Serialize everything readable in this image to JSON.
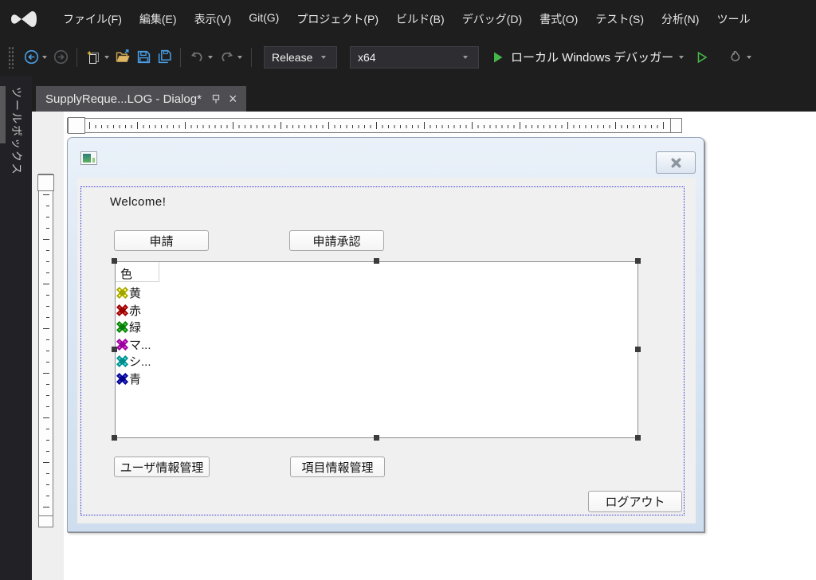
{
  "menu_bar": {
    "items": [
      "ファイル(F)",
      "編集(E)",
      "表示(V)",
      "Git(G)",
      "プロジェクト(P)",
      "ビルド(B)",
      "デバッグ(D)",
      "書式(O)",
      "テスト(S)",
      "分析(N)",
      "ツール"
    ]
  },
  "toolbar": {
    "configuration": "Release",
    "platform": "x64",
    "run_label": "ローカル Windows デバッガー",
    "icons": [
      "navigate-back",
      "navigate-forward",
      "new-item",
      "open-file",
      "save",
      "save-all",
      "undo",
      "redo",
      "start-debugging",
      "start-without-debugging",
      "hot-reload"
    ]
  },
  "document_tab": {
    "title": "SupplyReque...LOG - Dialog*",
    "icons": [
      "pin",
      "close"
    ]
  },
  "toolbox_tab": {
    "label": "ツールボックス"
  },
  "designer": {
    "dialog": {
      "welcome_label": "Welcome!",
      "apply_button": "申請",
      "approve_button": "申請承認",
      "user_mgmt_button": "ユーザ情報管理",
      "item_mgmt_button": "項目情報管理",
      "logout_button": "ログアウト",
      "title_bar_icons": [
        "app-icon",
        "close"
      ],
      "list": {
        "column_header": "色",
        "rows": [
          {
            "label": "黄",
            "dark": "#a2a200",
            "light": "#ffff4d"
          },
          {
            "label": "赤",
            "dark": "#990000",
            "light": "#d93a3a"
          },
          {
            "label": "緑",
            "dark": "#067d06",
            "light": "#3ecc3e"
          },
          {
            "label": "マ...",
            "dark": "#990099",
            "light": "#e040e0"
          },
          {
            "label": "シ...",
            "dark": "#008b8b",
            "light": "#3ed6d6"
          },
          {
            "label": "青",
            "dark": "#00008f",
            "light": "#3a3ae0"
          }
        ]
      }
    }
  },
  "colors": {
    "accent_green": "#45b649",
    "accent_blue": "#4aa0e8",
    "selection_border": "#3434d6",
    "dialog_titlebar": "#dde8f4",
    "dialog_client": "#f0f0f0"
  }
}
